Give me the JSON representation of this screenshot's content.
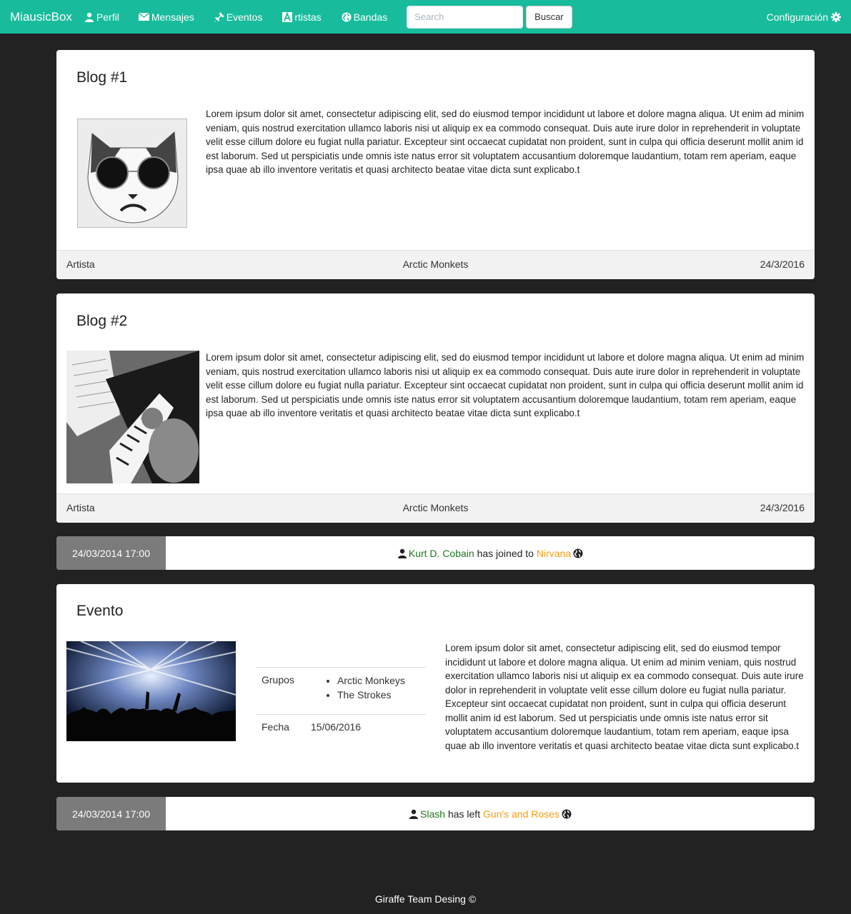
{
  "navbar": {
    "brand": "MiausicBox",
    "items": [
      {
        "label": "Perfil",
        "icon": "user-icon"
      },
      {
        "label": "Mensajes",
        "icon": "envelope-icon"
      },
      {
        "label": "Eventos",
        "icon": "pushpin-icon"
      },
      {
        "label": "rtistas",
        "icon": "font-a-icon"
      },
      {
        "label": "Bandas",
        "icon": "globe-icon"
      }
    ],
    "search_placeholder": "Search",
    "search_button": "Buscar",
    "config_label": "Configuración"
  },
  "blogs": [
    {
      "title": "Blog #1",
      "text": "Lorem ipsum dolor sit amet, consectetur adipiscing elit, sed do eiusmod tempor incididunt ut labore et dolore magna aliqua. Ut enim ad minim veniam, quis nostrud exercitation ullamco laboris nisi ut aliquip ex ea commodo consequat. Duis aute irure dolor in reprehenderit in voluptate velit esse cillum dolore eu fugiat nulla pariatur. Excepteur sint occaecat cupidatat non proident, sunt in culpa qui officia deserunt mollit anim id est laborum. Sed ut perspiciatis unde omnis iste natus error sit voluptatem accusantium doloremque laudantium, totam rem aperiam, eaque ipsa quae ab illo inventore veritatis et quasi architecto beatae vitae dicta sunt explicabo.t",
      "footer_left": "Artista",
      "footer_center": "Arctic Monkets",
      "footer_right": "24/3/2016"
    },
    {
      "title": "Blog #2",
      "text": "Lorem ipsum dolor sit amet, consectetur adipiscing elit, sed do eiusmod tempor incididunt ut labore et dolore magna aliqua. Ut enim ad minim veniam, quis nostrud exercitation ullamco laboris nisi ut aliquip ex ea commodo consequat. Duis aute irure dolor in reprehenderit in voluptate velit esse cillum dolore eu fugiat nulla pariatur. Excepteur sint occaecat cupidatat non proident, sunt in culpa qui officia deserunt mollit anim id est laborum. Sed ut perspiciatis unde omnis iste natus error sit voluptatem accusantium doloremque laudantium, totam rem aperiam, eaque ipsa quae ab illo inventore veritatis et quasi architecto beatae vitae dicta sunt explicabo.t",
      "footer_left": "Artista",
      "footer_center": "Arctic Monkets",
      "footer_right": "24/3/2016"
    }
  ],
  "activities": [
    {
      "timestamp": "24/03/2014 17:00",
      "user": "Kurt D. Cobain",
      "action": "has joined to",
      "band": "Nirvana"
    },
    {
      "timestamp": "24/03/2014 17:00",
      "user": "Slash",
      "action": "has left",
      "band": "Gun's and Roses"
    }
  ],
  "event": {
    "title": "Evento",
    "groups_label": "Grupos",
    "groups": [
      "Arctic Monkeys",
      "The Strokes"
    ],
    "date_label": "Fecha",
    "date": "15/06/2016",
    "text": "Lorem ipsum dolor sit amet, consectetur adipiscing elit, sed do eiusmod tempor incididunt ut labore et dolore magna aliqua. Ut enim ad minim veniam, quis nostrud exercitation ullamco laboris nisi ut aliquip ex ea commodo consequat. Duis aute irure dolor in reprehenderit in voluptate velit esse cillum dolore eu fugiat nulla pariatur. Excepteur sint occaecat cupidatat non proident, sunt in culpa qui officia deserunt mollit anim id est laborum. Sed ut perspiciatis unde omnis iste natus error sit voluptatem accusantium doloremque laudantium, totam rem aperiam, eaque ipsa quae ab illo inventore veritatis et quasi architecto beatae vitae dicta sunt explicabo.t"
  },
  "footer": "Giraffe Team Desing ©",
  "colors": {
    "navbar": "#18bc9c",
    "background": "#222222",
    "user_link": "#1e7a1e",
    "band_link": "#f39c12",
    "timestamp_bg": "#7b7b7b"
  }
}
